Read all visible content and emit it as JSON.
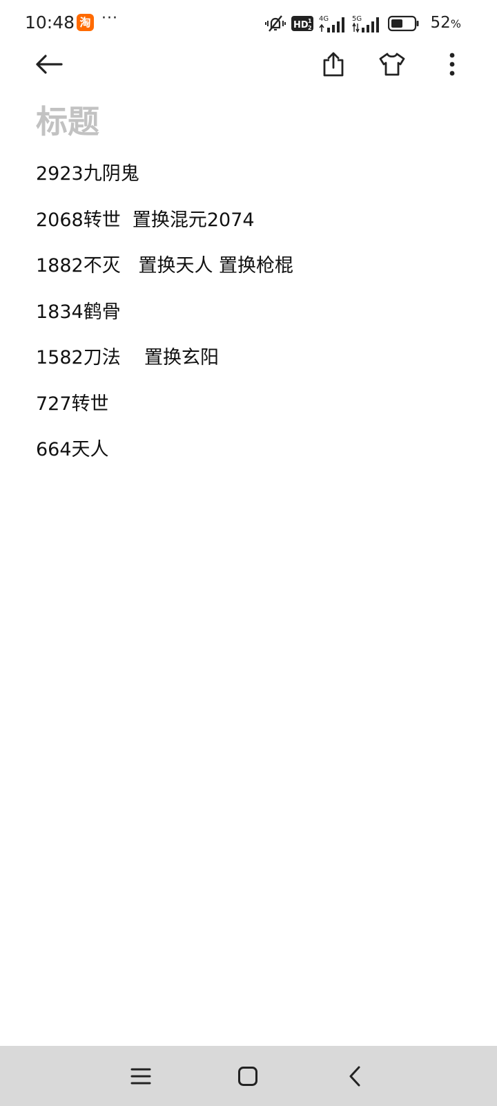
{
  "status_bar": {
    "time": "10:48",
    "app_badge": "淘",
    "more": "···",
    "network_4g": "4G",
    "network_5g": "5G",
    "hd_label": "HD",
    "battery_value": "52",
    "battery_unit": "%",
    "battery_level": 0.52,
    "icons": [
      "taobao-app-icon",
      "vibrate-mute-icon",
      "hd-volte-icon",
      "signal-4g-icon",
      "signal-5g-icon",
      "battery-icon"
    ]
  },
  "toolbar": {
    "icons": [
      "back-arrow-icon",
      "share-icon",
      "theme-shirt-icon",
      "more-vert-icon"
    ]
  },
  "note": {
    "title_placeholder": "标题",
    "lines": [
      "2923九阴鬼",
      "2068转世  置换混元2074",
      "1882不灭   置换天人 置换枪棍",
      "1834鹤骨",
      "1582刀法    置换玄阳",
      "727转世",
      "664天人"
    ]
  },
  "navbar": {
    "icons": [
      "menu-icon",
      "home-square-icon",
      "back-chevron-icon"
    ]
  },
  "colors": {
    "background": "#ffffff",
    "title_placeholder": "#c2c2c2",
    "text": "#111111",
    "navbar": "#d9d9d9",
    "app_badge": "#ff6a00"
  }
}
